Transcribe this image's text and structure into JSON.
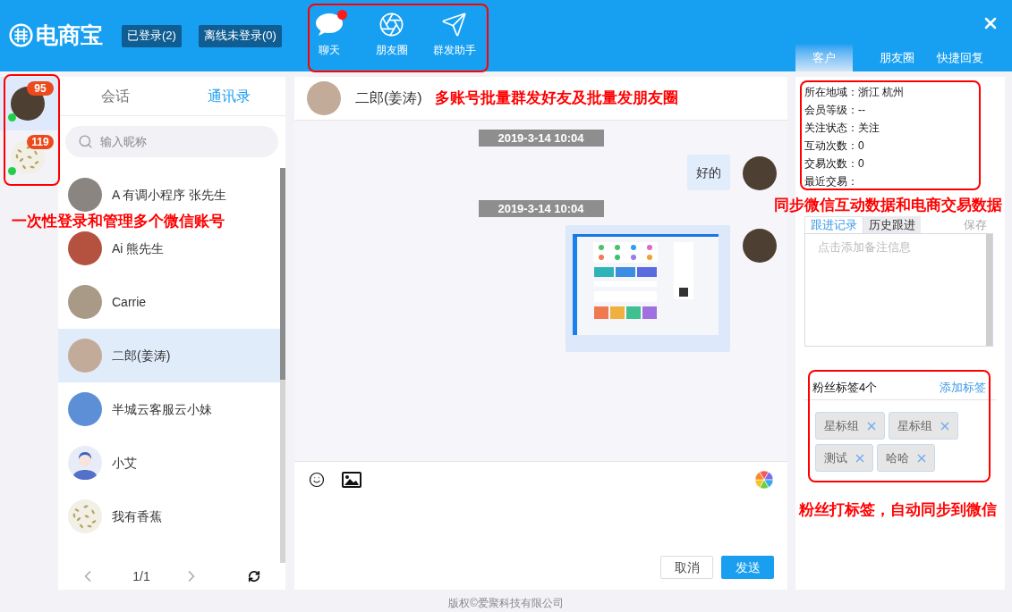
{
  "topbar": {
    "logo": "电商宝",
    "status_buttons": [
      "已登录(2)",
      "离线未登录(0)"
    ],
    "nav": [
      {
        "kind": "chat",
        "label": "聊天",
        "dot": true
      },
      {
        "kind": "moments",
        "label": "朋友圈",
        "dot": false
      },
      {
        "kind": "broadcast",
        "label": "群发助手",
        "dot": false
      }
    ],
    "tabs": [
      {
        "label": "客户",
        "selected": true
      },
      {
        "label": "朋友圈",
        "selected": false
      },
      {
        "label": "快捷回复",
        "selected": false
      }
    ]
  },
  "accounts": {
    "items": [
      {
        "badge": "95",
        "avatar": {
          "kind": "photo"
        },
        "online": true,
        "selected": true
      },
      {
        "badge": "119",
        "avatar": {
          "kind": "pattern"
        },
        "online": true,
        "selected": false
      }
    ],
    "note": "一次性登录和管理多个微信账号"
  },
  "contacts": {
    "tabs": [
      {
        "label": "会话",
        "selected": false
      },
      {
        "label": "通讯录",
        "selected": true
      }
    ],
    "search": {
      "placeholder": "输入昵称"
    },
    "items": [
      {
        "name": "A 有调小程序 张先生",
        "avatar": {
          "kind": "photo"
        },
        "selected": false
      },
      {
        "name": "Ai 熊先生",
        "avatar": {
          "kind": "photo"
        },
        "selected": false
      },
      {
        "name": "Carrie",
        "avatar": {
          "kind": "photo"
        },
        "selected": false
      },
      {
        "name": "二郎(姜涛)",
        "avatar": {
          "kind": "photo"
        },
        "selected": true
      },
      {
        "name": "半城云客服云小妹",
        "avatar": {
          "kind": "photo"
        },
        "selected": false
      },
      {
        "name": "小艾",
        "avatar": {
          "kind": "silhouette"
        },
        "selected": false
      },
      {
        "name": "我有香蕉",
        "avatar": {
          "kind": "pattern"
        },
        "selected": false
      }
    ],
    "pager": "1/1"
  },
  "chat": {
    "header": {
      "name": "二郎(姜涛)",
      "note": "多账号批量群发好友及批量发朋友圈"
    },
    "messages": [
      {
        "kind": "time",
        "text": "2019-3-14 10:04"
      },
      {
        "kind": "text",
        "text": "好的"
      },
      {
        "kind": "time",
        "text": "2019-3-14 10:04"
      },
      {
        "kind": "image"
      }
    ],
    "buttons": [
      {
        "label": "取消",
        "primary": false
      },
      {
        "label": "发送",
        "primary": true
      }
    ]
  },
  "customer": {
    "info_lines": [
      "所在地域：浙江 杭州",
      "会员等级：--",
      "关注状态：关注",
      "互动次数：0",
      "交易次数：0",
      "最近交易："
    ],
    "note": "同步微信互动数据和电商交易数据",
    "follow_tabs": [
      {
        "label": "跟进记录",
        "selected": true
      },
      {
        "label": "历史跟进",
        "selected": false
      }
    ],
    "save": "保存",
    "placeholder": "点击添加备注信息",
    "tags": {
      "title": "粉丝标签4个",
      "add": "添加标签",
      "items": [
        "星标组",
        "星标组",
        "测试",
        "哈哈"
      ],
      "note": "粉丝打标签，自动同步到微信"
    }
  },
  "footer": "版权©爱聚科技有限公司"
}
